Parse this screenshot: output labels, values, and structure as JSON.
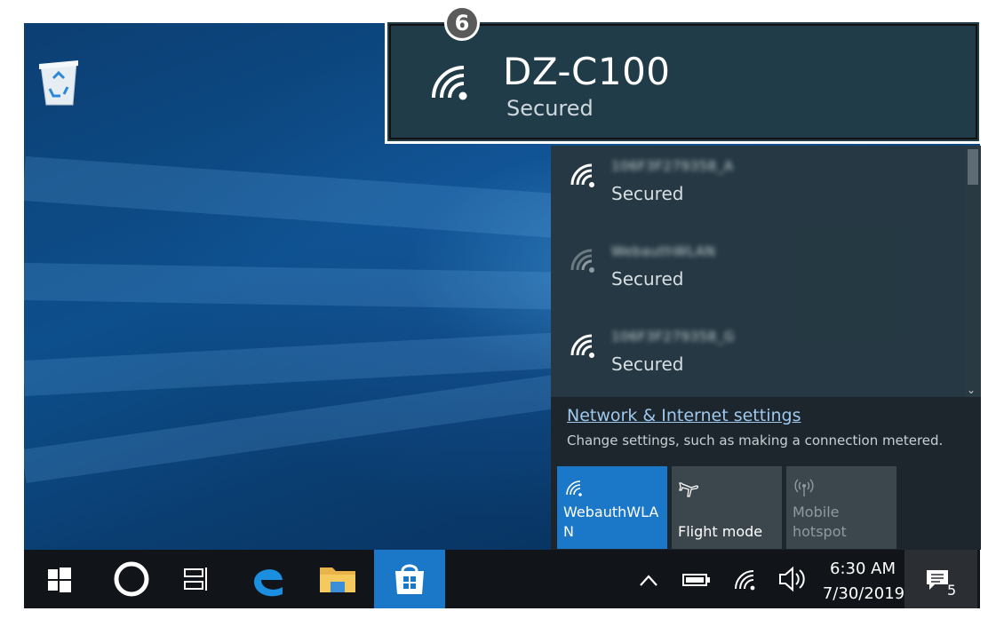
{
  "callout": {
    "number": "6"
  },
  "selected_network": {
    "ssid": "DZ-C100",
    "status": "Secured"
  },
  "networks": [
    {
      "ssid": "106F3F279358_A",
      "status": "Secured"
    },
    {
      "ssid": "WebauthWLAN",
      "status": "Secured"
    },
    {
      "ssid": "106F3F279358_G",
      "status": "Secured"
    }
  ],
  "settings": {
    "link": "Network & Internet settings",
    "description": "Change settings, such as making a connection metered."
  },
  "tiles": [
    {
      "label": "WebauthWLA\nN",
      "icon": "wifi-icon",
      "color": "#1b78c8"
    },
    {
      "label": "Flight mode",
      "icon": "airplane-icon",
      "color": "#3b474d"
    },
    {
      "label": "Mobile\nhotspot",
      "icon": "hotspot-icon",
      "color": "#3b474d"
    }
  ],
  "taskbar": {
    "time": "6:30 AM",
    "date": "7/30/2019",
    "notifications": "5"
  }
}
